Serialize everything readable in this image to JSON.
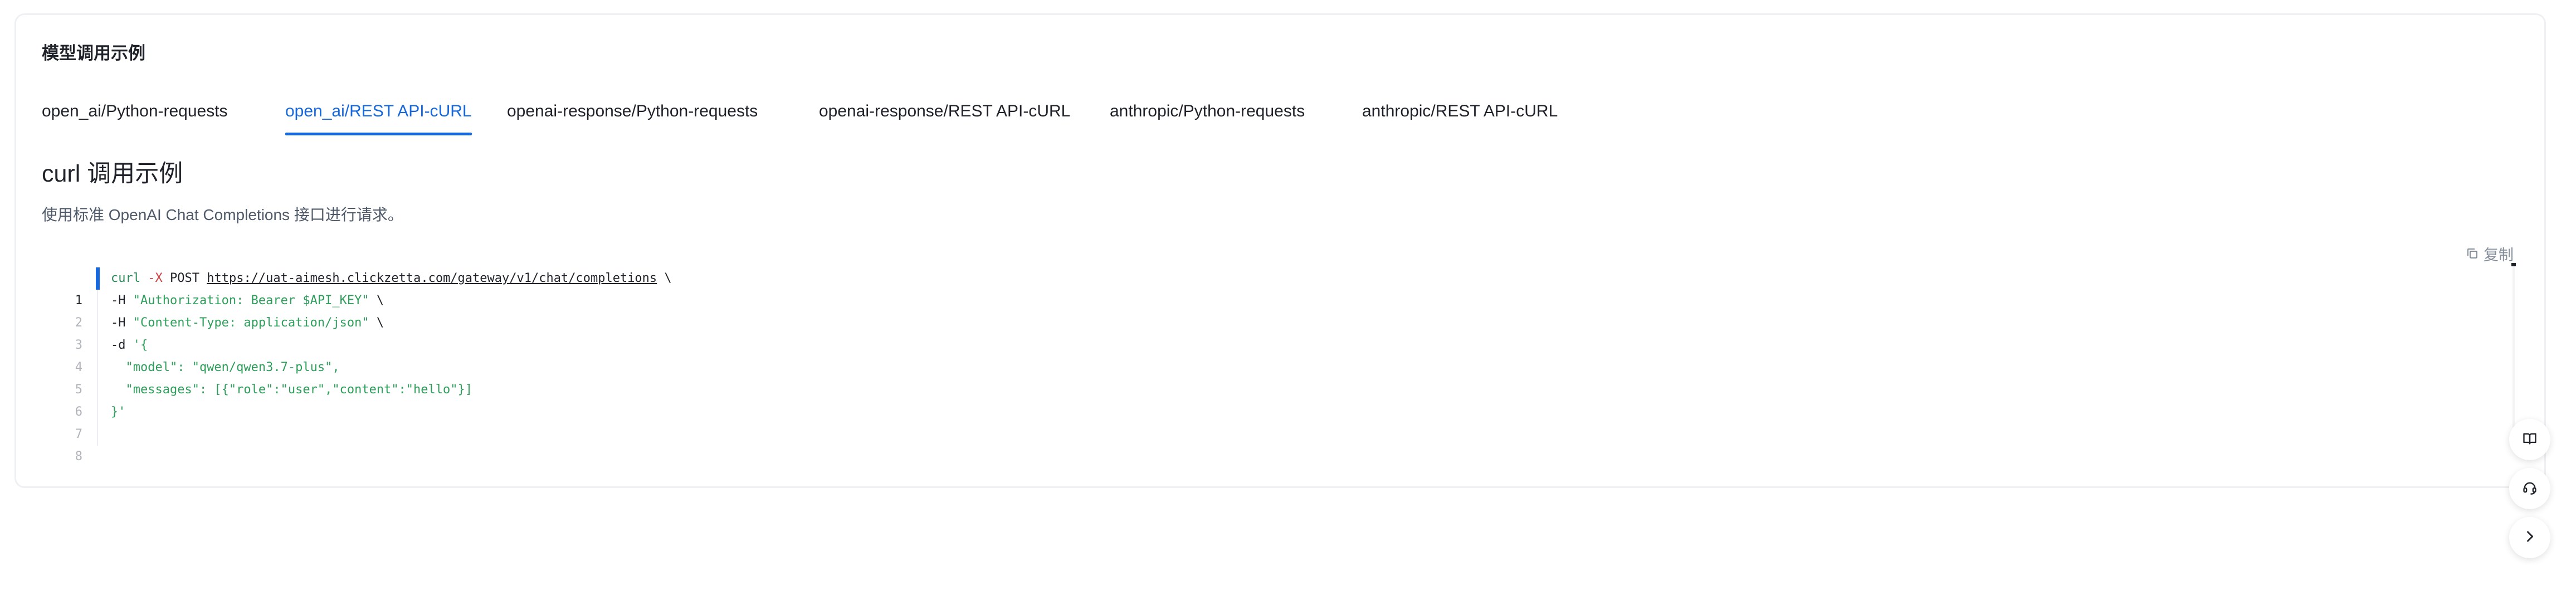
{
  "section": {
    "title": "模型调用示例"
  },
  "tabs": [
    {
      "label": "open_ai/Python-requests",
      "active": false
    },
    {
      "label": "open_ai/REST API-cURL",
      "active": true
    },
    {
      "label": "openai-response/Python-requests",
      "active": false
    },
    {
      "label": "openai-response/REST API-cURL",
      "active": false
    },
    {
      "label": "anthropic/Python-requests",
      "active": false
    },
    {
      "label": "anthropic/REST API-cURL",
      "active": false
    }
  ],
  "content": {
    "heading": "curl 调用示例",
    "description": "使用标准 OpenAI Chat Completions 接口进行请求。",
    "copy_label": "复制"
  },
  "code": {
    "line_numbers": [
      "1",
      "2",
      "3",
      "4",
      "5",
      "6",
      "7",
      "8"
    ],
    "current_line": 1,
    "lines": [
      {
        "cmd": "curl",
        "flag": " -X",
        "plain": " POST ",
        "url": "https://uat-aimesh.clickzetta.com/gateway/v1/chat/completions",
        "tail": " \\"
      },
      {
        "flag": "-H",
        "str": " \"Authorization: Bearer $API_KEY\"",
        "tail": " \\"
      },
      {
        "flag": "-H",
        "str": " \"Content-Type: application/json\"",
        "tail": " \\"
      },
      {
        "flag": "-d",
        "str": " '{"
      },
      {
        "str": "  \"model\": \"qwen/qwen3.7-plus\","
      },
      {
        "str": "  \"messages\": [{\"role\":\"user\",\"content\":\"hello\"}]"
      },
      {
        "str": "}'"
      },
      {}
    ]
  },
  "colors": {
    "accent": "#1668dc",
    "text": "#1f2329",
    "muted": "#86909c",
    "string": "#2e9e5b",
    "flag": "#d14343"
  },
  "floating_buttons": [
    {
      "icon": "book-icon"
    },
    {
      "icon": "support-icon"
    },
    {
      "icon": "chevron-right-icon"
    }
  ]
}
